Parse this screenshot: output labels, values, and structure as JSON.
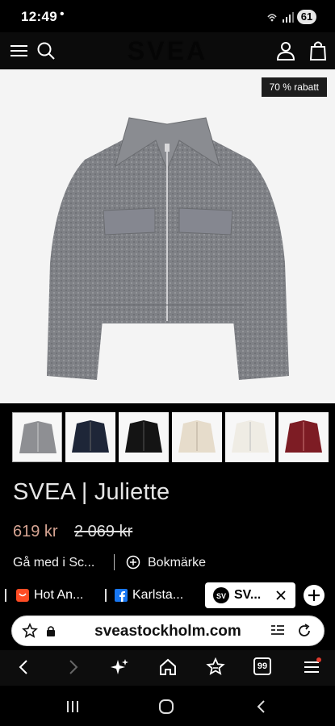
{
  "status_bar": {
    "time": "12:49",
    "dot": "•",
    "battery": "61"
  },
  "site_header": {
    "brand": "SVEA",
    "icons": [
      "menu-icon",
      "search-icon",
      "account-icon",
      "bag-icon"
    ]
  },
  "product": {
    "discount_badge": "70 % rabatt",
    "title": "SVEA | Juliette",
    "price": "619 kr",
    "original_price": "2 069 kr",
    "thumbnail_colors": [
      "#8e8f93",
      "#1e2638",
      "#141414",
      "#e6dccb",
      "#efece4",
      "#7d1c24"
    ]
  },
  "actions": {
    "join_label": "Gå med i Sc...",
    "bookmark_label": "Bokmärke"
  },
  "browser_tabs": [
    {
      "label": "Hot An...",
      "icon": "aliexpress-icon",
      "active": false
    },
    {
      "label": "Karlsta...",
      "icon": "facebook-icon",
      "active": false
    },
    {
      "label": "SV...",
      "icon": "svea-icon",
      "active": true
    }
  ],
  "address_bar": {
    "url": "sveastockholm.com"
  },
  "bottom_nav": {
    "tab_count": "99"
  },
  "colors": {
    "accent_price": "#d6a492",
    "badge_bg": "#1d1d1d",
    "facebook": "#1877f2",
    "aliexpress": "#ff4c24"
  }
}
